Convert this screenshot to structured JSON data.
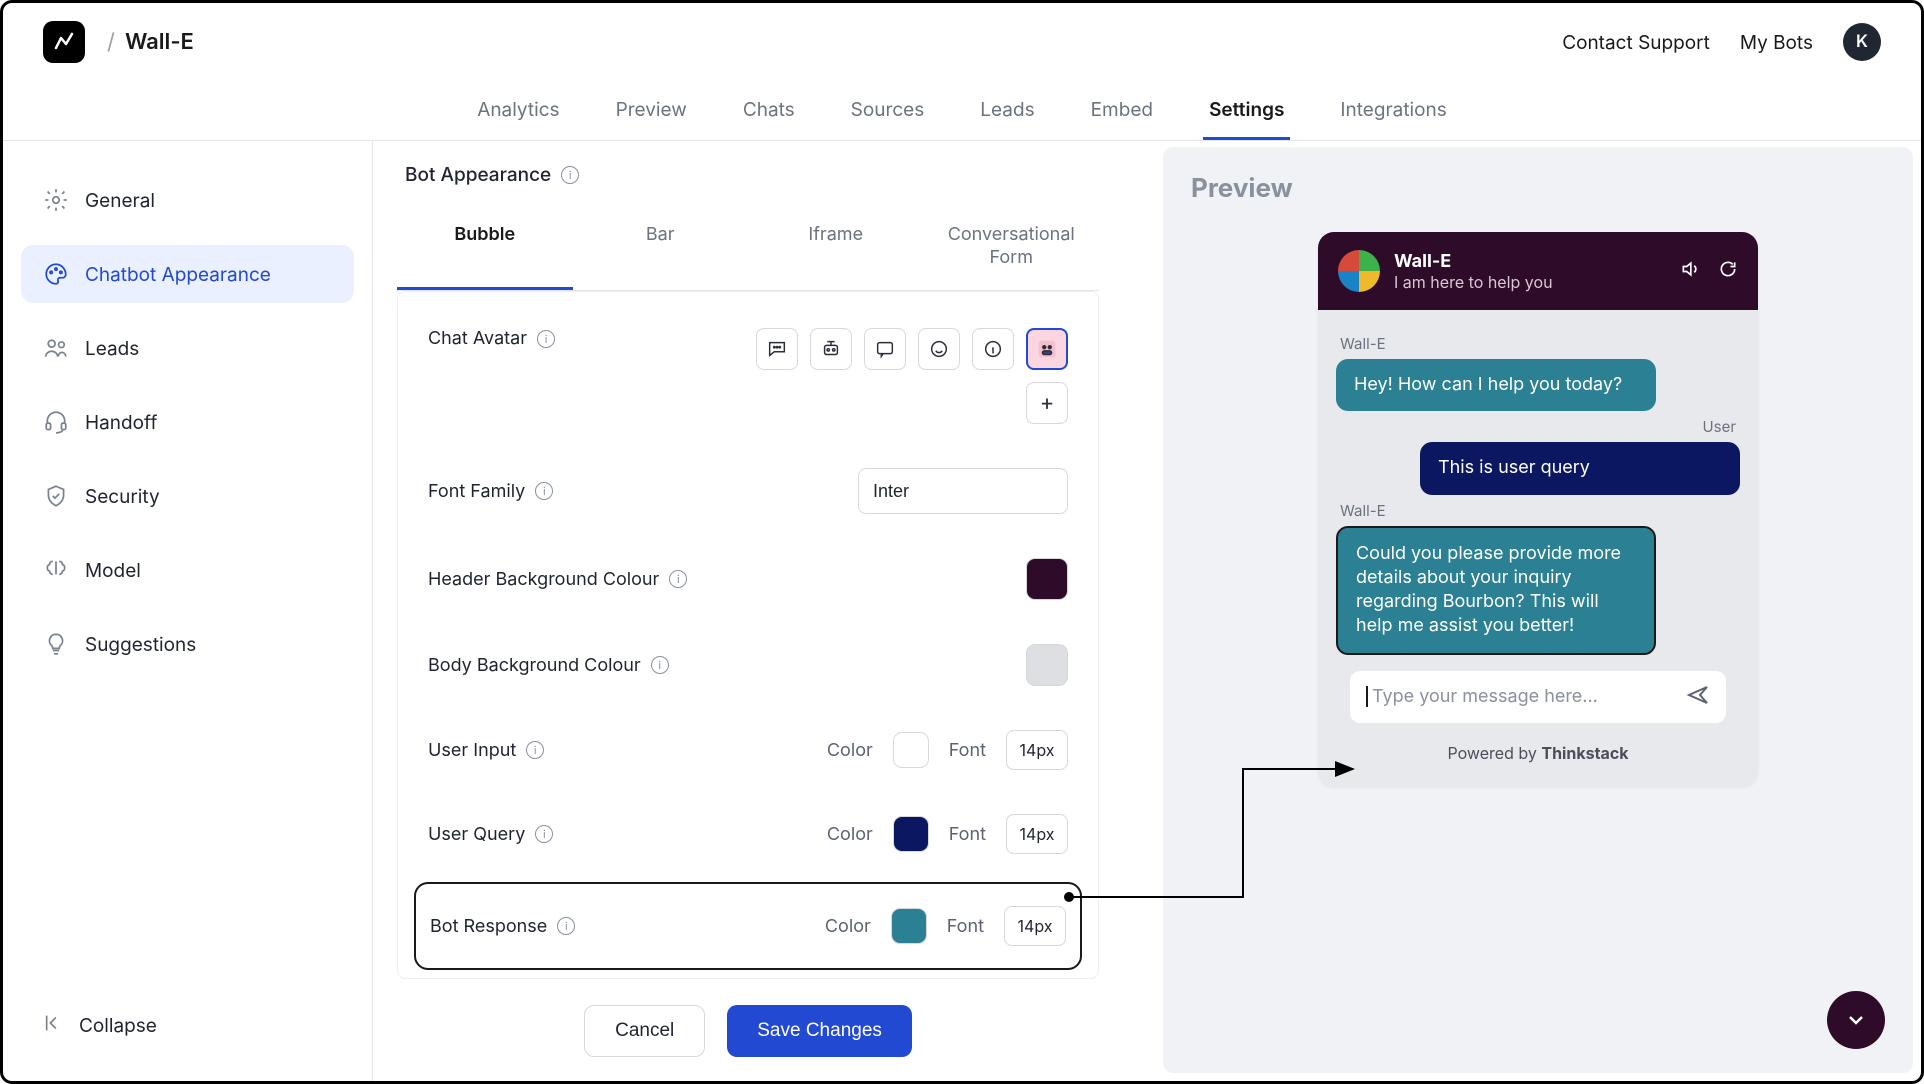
{
  "header": {
    "bot_name": "Wall-E",
    "contact": "Contact Support",
    "my_bots": "My Bots",
    "avatar_letter": "K"
  },
  "tabs": [
    "Analytics",
    "Preview",
    "Chats",
    "Sources",
    "Leads",
    "Embed",
    "Settings",
    "Integrations"
  ],
  "tabs_active_index": 6,
  "sidebar": {
    "items": [
      {
        "label": "General",
        "icon": "gear"
      },
      {
        "label": "Chatbot Appearance",
        "icon": "palette"
      },
      {
        "label": "Leads",
        "icon": "people"
      },
      {
        "label": "Handoff",
        "icon": "headset"
      },
      {
        "label": "Security",
        "icon": "shield"
      },
      {
        "label": "Model",
        "icon": "brain"
      },
      {
        "label": "Suggestions",
        "icon": "bulb"
      }
    ],
    "active_index": 1,
    "collapse": "Collapse"
  },
  "section": {
    "title": "Bot Appearance",
    "subtabs": [
      "Bubble",
      "Bar",
      "Iframe",
      "Conversational Form"
    ],
    "subtab_active_index": 0
  },
  "form": {
    "chat_avatar_label": "Chat Avatar",
    "font_family_label": "Font Family",
    "font_family_value": "Inter",
    "header_bg_label": "Header Background Colour",
    "body_bg_label": "Body Background Colour",
    "user_input_label": "User Input",
    "user_query_label": "User Query",
    "bot_response_label": "Bot Response",
    "color_label": "Color",
    "font_label": "Font",
    "font_size_user_input": "14px",
    "font_size_user_query": "14px",
    "font_size_bot_response": "14px",
    "colors": {
      "header_bg": "#2f0b2a",
      "body_bg": "#dedfe3",
      "user_input": "#ffffff",
      "user_query": "#0b1861",
      "bot_response": "#2b8093"
    }
  },
  "actions": {
    "cancel": "Cancel",
    "save": "Save Changes"
  },
  "preview": {
    "title": "Preview",
    "bot_name": "Wall-E",
    "bot_sub": "I am here to help you",
    "sender_bot": "Wall-E",
    "sender_user": "User",
    "msg_greeting": "Hey! How can I help you today?",
    "msg_user": "This is user query",
    "msg_bot_followup": "Could you please provide more details about your inquiry regarding Bourbon? This will help me assist you better!",
    "input_placeholder": "Type your message here...",
    "powered_by_prefix": "Powered by ",
    "powered_by_name": "Thinkstack"
  }
}
